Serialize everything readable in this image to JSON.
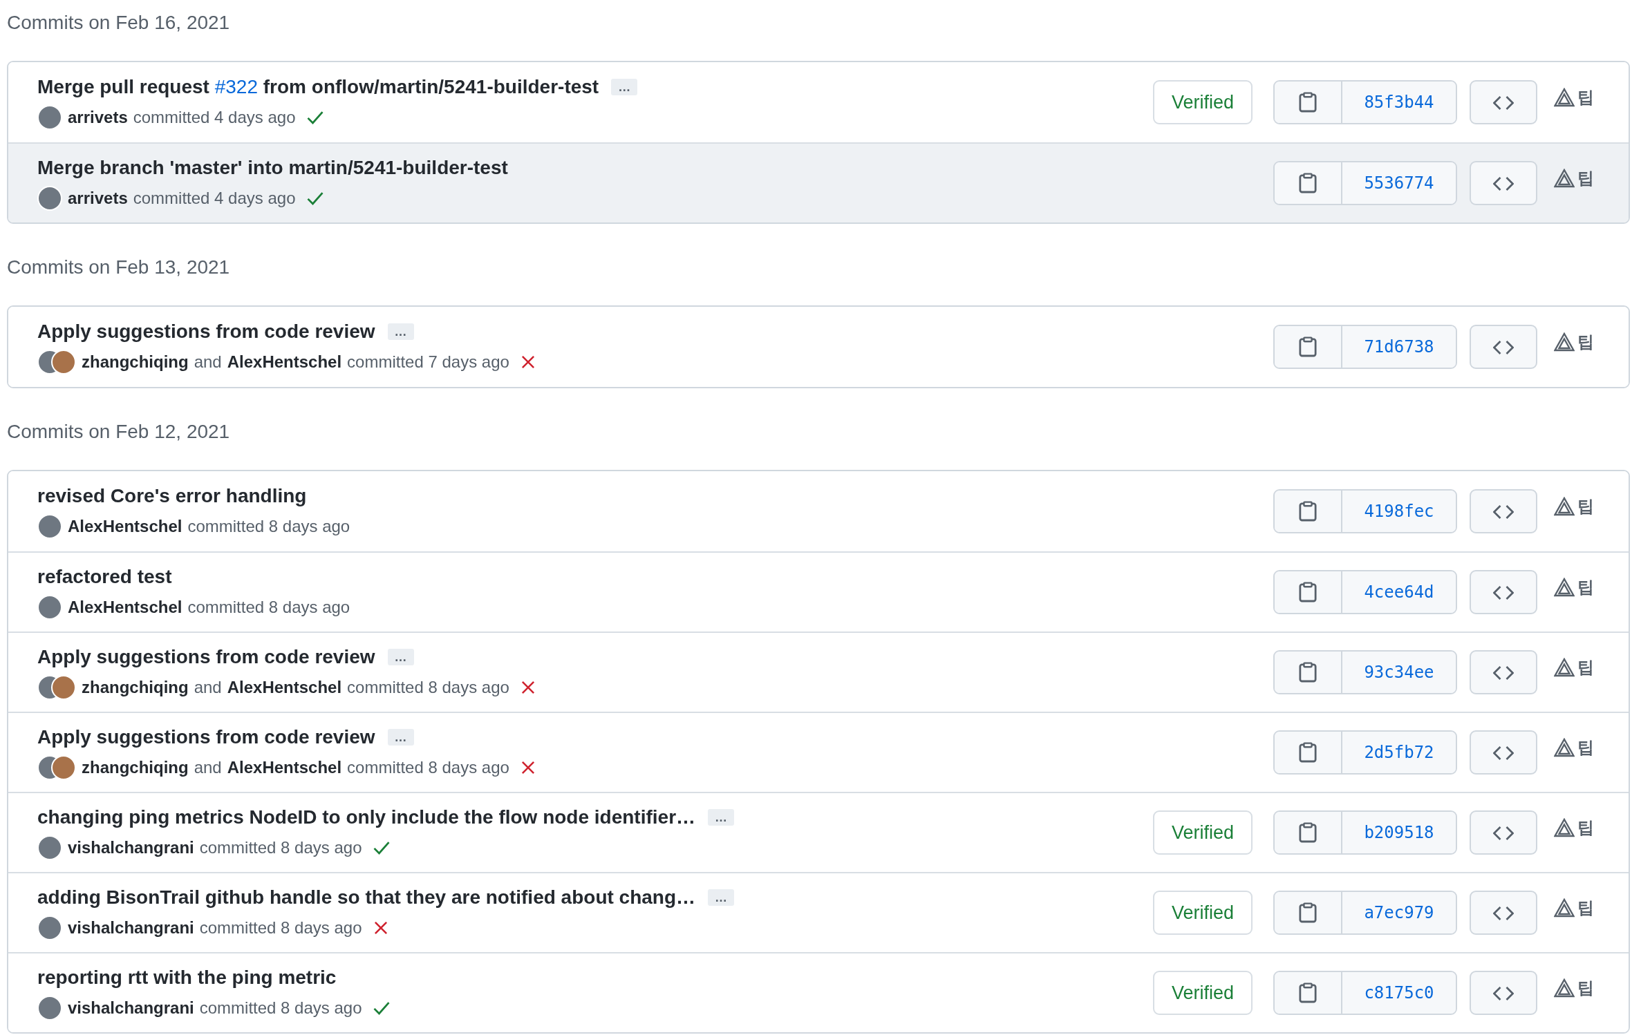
{
  "groups": [
    {
      "date": "Commits on Feb 16, 2021",
      "commits": [
        {
          "title": [
            {
              "kind": "text",
              "text": "Merge pull request "
            },
            {
              "kind": "link",
              "text": "#322"
            },
            {
              "kind": "text",
              "text": " from onflow/martin/5241-builder-test"
            }
          ],
          "more": "…",
          "highlighted": false,
          "authors": [
            "arrivets"
          ],
          "verb": "committed",
          "time": "4 days ago",
          "checks_passed": true,
          "verified": "Verified",
          "sha": "85f3b44",
          "tip": "팁"
        },
        {
          "title": [
            {
              "kind": "text",
              "text": "Merge branch 'master' into martin/5241-builder-test"
            }
          ],
          "highlighted": true,
          "authors": [
            "arrivets"
          ],
          "verb": "committed",
          "time": "4 days ago",
          "checks_passed": true,
          "sha": "5536774",
          "tip": "팁"
        }
      ]
    },
    {
      "date": "Commits on Feb 13, 2021",
      "commits": [
        {
          "title": [
            {
              "kind": "text",
              "text": "Apply suggestions from code review"
            }
          ],
          "more": "…",
          "highlighted": false,
          "authors": [
            "zhangchiqing",
            "AlexHentschel"
          ],
          "joiner": "and",
          "verb": "committed",
          "time": "7 days ago",
          "checks_passed": false,
          "sha": "71d6738",
          "tip": "팁"
        }
      ]
    },
    {
      "date": "Commits on Feb 12, 2021",
      "commits": [
        {
          "title": [
            {
              "kind": "text",
              "text": "revised Core's error handling"
            }
          ],
          "highlighted": false,
          "authors": [
            "AlexHentschel"
          ],
          "verb": "committed",
          "time": "8 days ago",
          "sha": "4198fec",
          "tip": "팁"
        },
        {
          "title": [
            {
              "kind": "text",
              "text": "refactored test"
            }
          ],
          "highlighted": false,
          "authors": [
            "AlexHentschel"
          ],
          "verb": "committed",
          "time": "8 days ago",
          "sha": "4cee64d",
          "tip": "팁"
        },
        {
          "title": [
            {
              "kind": "text",
              "text": "Apply suggestions from code review"
            }
          ],
          "more": "…",
          "highlighted": false,
          "authors": [
            "zhangchiqing",
            "AlexHentschel"
          ],
          "joiner": "and",
          "verb": "committed",
          "time": "8 days ago",
          "checks_passed": false,
          "sha": "93c34ee",
          "tip": "팁"
        },
        {
          "title": [
            {
              "kind": "text",
              "text": "Apply suggestions from code review"
            }
          ],
          "more": "…",
          "highlighted": false,
          "authors": [
            "zhangchiqing",
            "AlexHentschel"
          ],
          "joiner": "and",
          "verb": "committed",
          "time": "8 days ago",
          "checks_passed": false,
          "sha": "2d5fb72",
          "tip": "팁"
        },
        {
          "title": [
            {
              "kind": "text",
              "text": "changing ping metrics NodeID to only include the flow node identifier…"
            }
          ],
          "more": "…",
          "highlighted": false,
          "authors": [
            "vishalchangrani"
          ],
          "verb": "committed",
          "time": "8 days ago",
          "checks_passed": true,
          "verified": "Verified",
          "sha": "b209518",
          "tip": "팁"
        },
        {
          "title": [
            {
              "kind": "text",
              "text": "adding BisonTrail github handle so that they are notified about chang…"
            }
          ],
          "more": "…",
          "highlighted": false,
          "authors": [
            "vishalchangrani"
          ],
          "verb": "committed",
          "time": "8 days ago",
          "checks_passed": false,
          "verified": "Verified",
          "sha": "a7ec979",
          "tip": "팁"
        },
        {
          "title": [
            {
              "kind": "text",
              "text": "reporting rtt with the ping metric"
            }
          ],
          "highlighted": false,
          "authors": [
            "vishalchangrani"
          ],
          "verb": "committed",
          "time": "8 days ago",
          "checks_passed": true,
          "verified": "Verified",
          "sha": "c8175c0",
          "tip": "팁"
        }
      ]
    }
  ]
}
